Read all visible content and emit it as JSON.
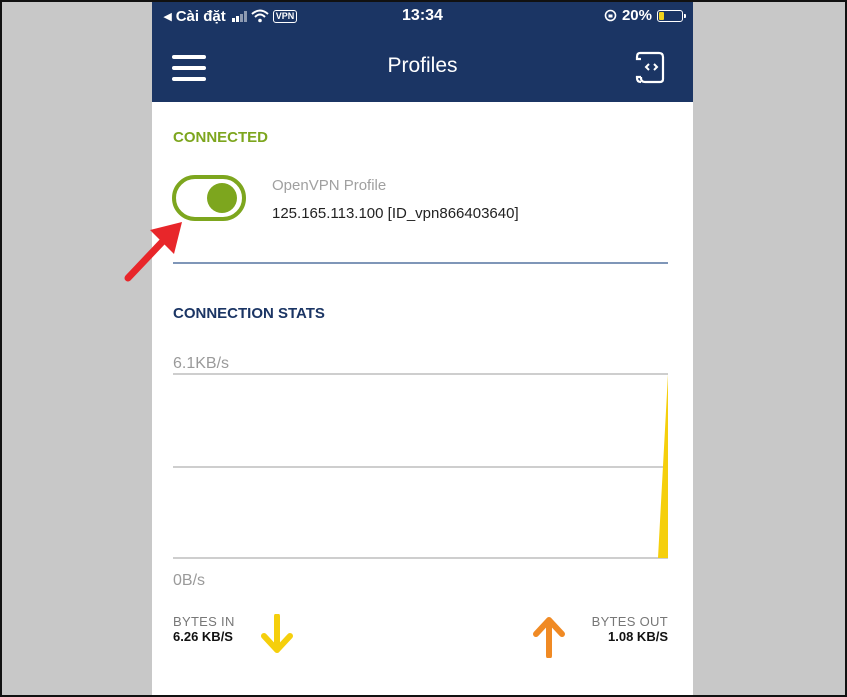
{
  "status_bar": {
    "carrier": "◂ Cài đặt",
    "vpn_badge": "VPN",
    "time": "13:34",
    "battery_percent": "20%",
    "battery_level": 0.2
  },
  "app_bar": {
    "title": "Profiles",
    "menu_icon": "hamburger-menu-icon",
    "import_icon": "import-profile-icon"
  },
  "connection": {
    "section_label": "CONNECTED",
    "toggle_on": true,
    "profile_name": "OpenVPN Profile",
    "profile_detail": "125.165.113.100 [ID_vpn866403640]"
  },
  "stats": {
    "section_label": "CONNECTION STATS",
    "bytes_in_label": "BYTES IN",
    "bytes_in_value": "6.26 KB/S",
    "bytes_out_label": "BYTES OUT",
    "bytes_out_value": "1.08 KB/S"
  },
  "chart_data": {
    "type": "area",
    "y_max_label": "6.1KB/s",
    "y_min_label": "0B/s",
    "ylim": [
      0,
      6.1
    ],
    "series_color": "#f5cf0c",
    "x": [
      0,
      1,
      2,
      3,
      4,
      5,
      6,
      7,
      8,
      9,
      10,
      11,
      12,
      13,
      14,
      15,
      16,
      17,
      18,
      19,
      20,
      21,
      22,
      23,
      24,
      25,
      26,
      27,
      28,
      29,
      30
    ],
    "values": [
      0,
      0,
      0,
      0,
      0,
      0,
      0,
      0,
      0,
      0,
      0,
      0,
      0,
      0,
      0,
      0,
      0,
      0,
      0,
      0,
      0,
      0,
      0,
      0,
      0,
      0,
      0,
      0,
      0,
      0,
      6.1
    ]
  },
  "colors": {
    "primary": "#1b3564",
    "connected_green": "#7da61e",
    "arrow_in": "#f5cf0c",
    "arrow_out": "#f08a24",
    "annotation": "#e8262a"
  }
}
